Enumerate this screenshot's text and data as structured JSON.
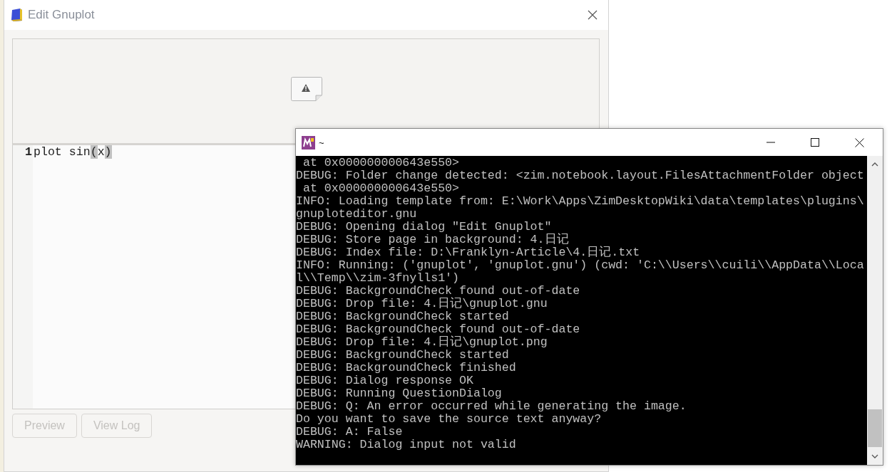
{
  "dialog": {
    "title": "Edit Gnuplot",
    "preview": {
      "kind": "broken-image"
    },
    "editor": {
      "lines": [
        {
          "number": "1",
          "segments": [
            {
              "text": "plot sin",
              "highlight": false
            },
            {
              "text": "(",
              "highlight": true
            },
            {
              "text": "x",
              "highlight": false
            },
            {
              "text": ")",
              "highlight": true
            }
          ]
        }
      ]
    },
    "buttons": [
      {
        "label": "Preview",
        "disabled": true
      },
      {
        "label": "View Log",
        "disabled": true
      }
    ]
  },
  "terminal": {
    "title": "~",
    "lines": [
      " at 0x000000000643e550>",
      "DEBUG: Folder change detected: <zim.notebook.layout.FilesAttachmentFolder object",
      " at 0x000000000643e550>",
      "INFO: Loading template from: E:\\Work\\Apps\\ZimDesktopWiki\\data\\templates\\plugins\\",
      "gnuploteditor.gnu",
      "DEBUG: Opening dialog \"Edit Gnuplot\"",
      "DEBUG: Store page in background: 4.日记",
      "DEBUG: Index file: D:\\Franklyn-Article\\4.日记.txt",
      "INFO: Running: ('gnuplot', 'gnuplot.gnu') (cwd: 'C:\\\\Users\\\\cuili\\\\AppData\\\\Loca",
      "l\\\\Temp\\\\zim-3fnylls1')",
      "DEBUG: BackgroundCheck found out-of-date",
      "DEBUG: Drop file: 4.日记\\gnuplot.gnu",
      "DEBUG: BackgroundCheck started",
      "DEBUG: BackgroundCheck found out-of-date",
      "DEBUG: Drop file: 4.日记\\gnuplot.png",
      "DEBUG: BackgroundCheck started",
      "DEBUG: BackgroundCheck finished",
      "DEBUG: Dialog response OK",
      "DEBUG: Running QuestionDialog",
      "DEBUG: Q: An error occurred while generating the image.",
      "Do you want to save the source text anyway?",
      "DEBUG: A: False",
      "WARNING: Dialog input not valid"
    ]
  }
}
